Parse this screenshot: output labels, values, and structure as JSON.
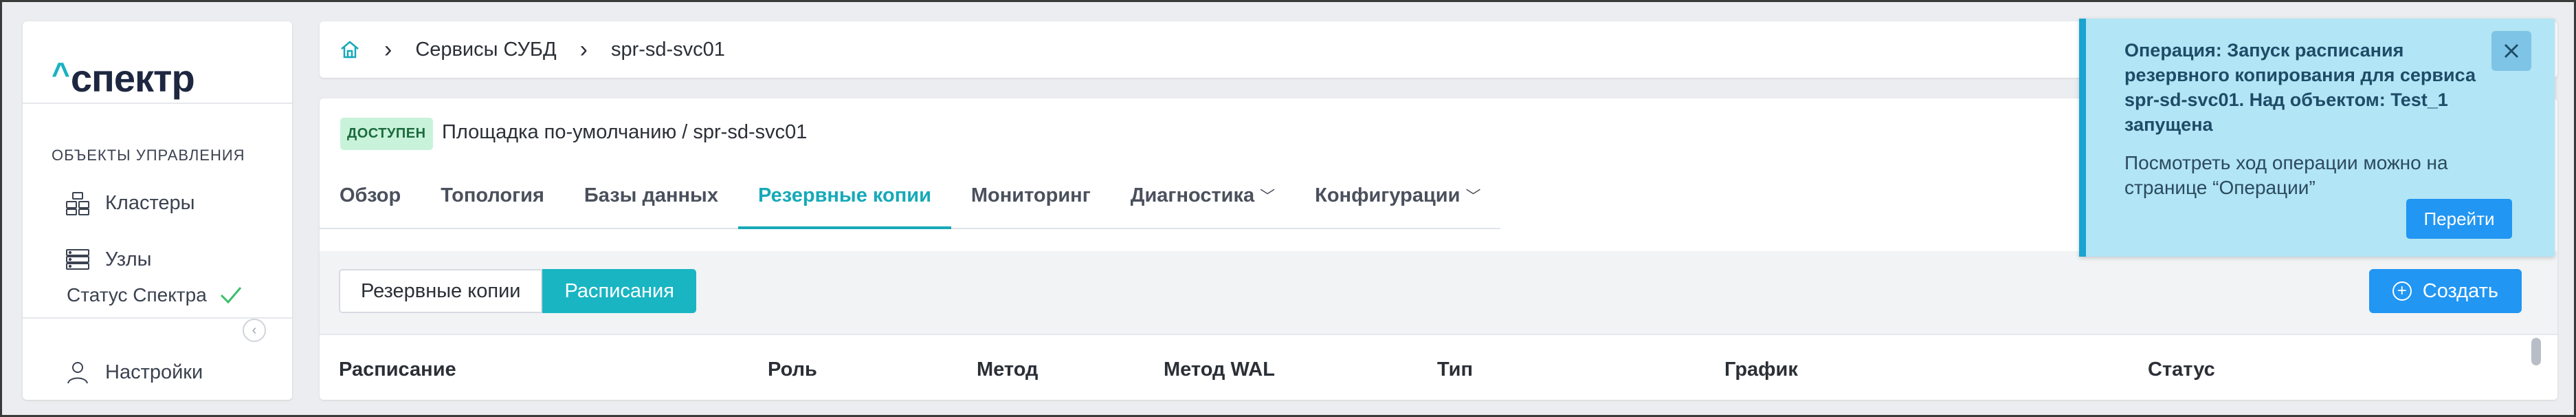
{
  "sidebar": {
    "logo_caret": "^",
    "logo_text": "спектр",
    "section_title": "ОБЪЕКТЫ УПРАВЛЕНИЯ",
    "items": [
      {
        "label": "Кластеры",
        "icon": "clusters-icon"
      },
      {
        "label": "Узлы",
        "icon": "nodes-icon"
      }
    ],
    "status_label": "Статус Спектра",
    "status_ok_icon": "check-icon",
    "settings_label": "Настройки",
    "collapse_icon": "chevron-left-icon"
  },
  "breadcrumb": {
    "home_icon": "home-icon",
    "items": [
      "Сервисы СУБД",
      "spr-sd-svc01"
    ],
    "separator": "›"
  },
  "service": {
    "status_badge": "ДОСТУПЕН",
    "location": "Площадка по-умолчанию /  spr-sd-svc01"
  },
  "tabs": [
    {
      "label": "Обзор"
    },
    {
      "label": "Топология"
    },
    {
      "label": "Базы данных"
    },
    {
      "label": "Резервные копии",
      "active": true
    },
    {
      "label": "Мониторинг"
    },
    {
      "label": "Диагностика",
      "dropdown": true
    },
    {
      "label": "Конфигурации",
      "dropdown": true
    }
  ],
  "segments": {
    "backups_label": "Резервные копии",
    "schedules_label": "Расписания",
    "active": "Расписания"
  },
  "create_button": "Создать",
  "table": {
    "columns": [
      "Расписание",
      "Роль",
      "Метод",
      "Метод WAL",
      "Тип",
      "График",
      "Статус"
    ]
  },
  "toast": {
    "title": "Операция: Запуск расписания резервного копирования для сервиса spr-sd-svc01. Над объектом: Test_1 запущена",
    "body": "Посмотреть ход операции можно на странице “Операции”",
    "go_button": "Перейти",
    "close_icon": "close-icon"
  },
  "colors": {
    "accent": "#16a9b8",
    "primary_button": "#2196f3",
    "toast_bg": "#b2e5f5",
    "toast_border": "#1aa3cf",
    "status_badge_bg": "#c8f3da"
  }
}
